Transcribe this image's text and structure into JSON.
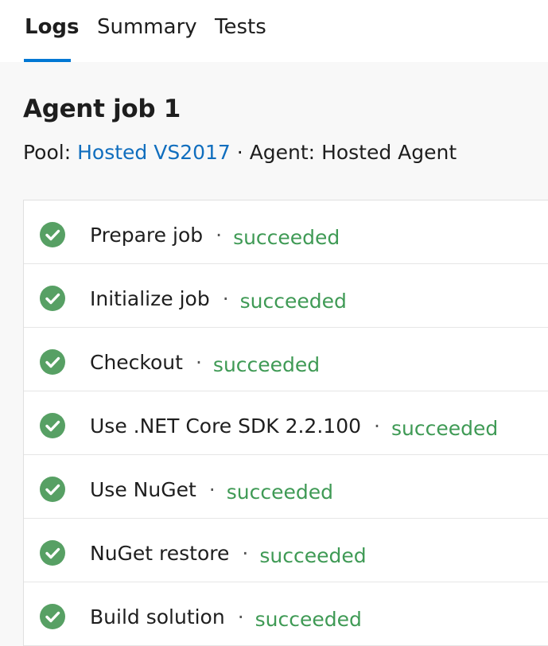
{
  "tabs": [
    {
      "label": "Logs",
      "selected": true
    },
    {
      "label": "Summary",
      "selected": false
    },
    {
      "label": "Tests",
      "selected": false
    }
  ],
  "job": {
    "title": "Agent job 1",
    "pool_label": "Pool:",
    "pool_value": "Hosted VS2017",
    "separator": "·",
    "agent_label": "Agent:",
    "agent_value": "Hosted Agent"
  },
  "steps": [
    {
      "name": "Prepare job",
      "separator": "·",
      "status": "succeeded",
      "icon": "success-check-icon"
    },
    {
      "name": "Initialize job",
      "separator": "·",
      "status": "succeeded",
      "icon": "success-check-icon"
    },
    {
      "name": "Checkout",
      "separator": "·",
      "status": "succeeded",
      "icon": "success-check-icon"
    },
    {
      "name": "Use .NET Core SDK 2.2.100",
      "separator": "·",
      "status": "succeeded",
      "icon": "success-check-icon"
    },
    {
      "name": "Use NuGet",
      "separator": "·",
      "status": "succeeded",
      "icon": "success-check-icon"
    },
    {
      "name": "NuGet restore",
      "separator": "·",
      "status": "succeeded",
      "icon": "success-check-icon"
    },
    {
      "name": "Build solution",
      "separator": "·",
      "status": "succeeded",
      "icon": "success-check-icon"
    }
  ],
  "colors": {
    "accent": "#0078d4",
    "link": "#106ebe",
    "success": "#3f9a55",
    "success_icon": "#57a064"
  }
}
